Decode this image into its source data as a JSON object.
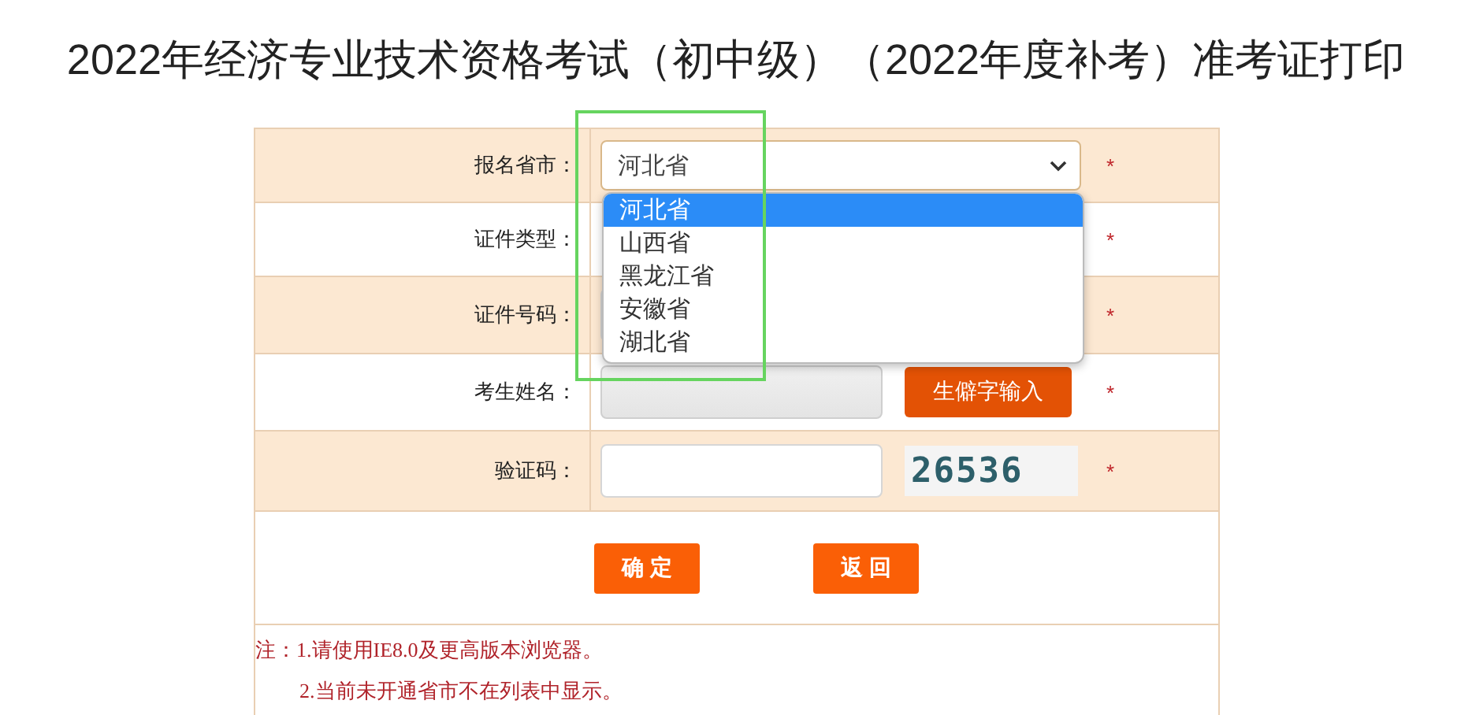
{
  "page_title": "2022年经济专业技术资格考试（初中级）（2022年度补考）准考证打印",
  "form": {
    "rows": [
      {
        "kind": "select",
        "label": "报名省市：",
        "value": "河北省",
        "required_mark": "*"
      },
      {
        "kind": "empty",
        "label": "证件类型：",
        "required_mark": "*"
      },
      {
        "kind": "input",
        "label": "证件号码：",
        "required_mark": "*"
      },
      {
        "kind": "input_button",
        "label": "考生姓名：",
        "disabled": true,
        "button": "生僻字输入",
        "required_mark": "*"
      },
      {
        "kind": "captcha",
        "label": "验证码：",
        "captcha": "26536",
        "required_mark": "*"
      }
    ],
    "buttons": [
      "确 定",
      "返 回"
    ],
    "notes": [
      "注：1.请使用IE8.0及更高版本浏览器。",
      "2.当前未开通省市不在列表中显示。"
    ]
  },
  "dropdown": {
    "options": [
      {
        "label": "河北省",
        "selected": true
      },
      {
        "label": "山西省",
        "selected": false
      },
      {
        "label": "黑龙江省",
        "selected": false
      },
      {
        "label": "安徽省",
        "selected": false
      },
      {
        "label": "湖北省",
        "selected": false
      }
    ]
  }
}
